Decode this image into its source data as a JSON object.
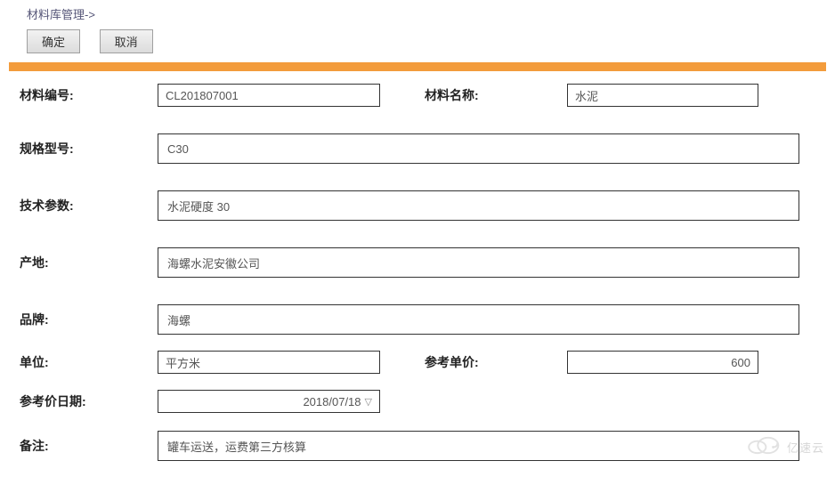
{
  "breadcrumb": "材料库管理->",
  "buttons": {
    "confirm": "确定",
    "cancel": "取消"
  },
  "labels": {
    "material_code": "材料编号:",
    "material_name": "材料名称:",
    "spec_model": "规格型号:",
    "tech_params": "技术参数:",
    "origin": "产地:",
    "brand": "品牌:",
    "unit": "单位:",
    "ref_price": "参考单价:",
    "ref_date": "参考价日期:",
    "remark": "备注:"
  },
  "values": {
    "material_code": "CL201807001",
    "material_name": "水泥",
    "spec_model": "C30",
    "tech_params": "水泥硬度 30",
    "origin": "海螺水泥安徽公司",
    "brand": "海螺",
    "unit": "平方米",
    "ref_price": "600",
    "ref_date": "2018/07/18",
    "remark": "罐车运送，运费第三方核算"
  },
  "watermark": "亿速云"
}
